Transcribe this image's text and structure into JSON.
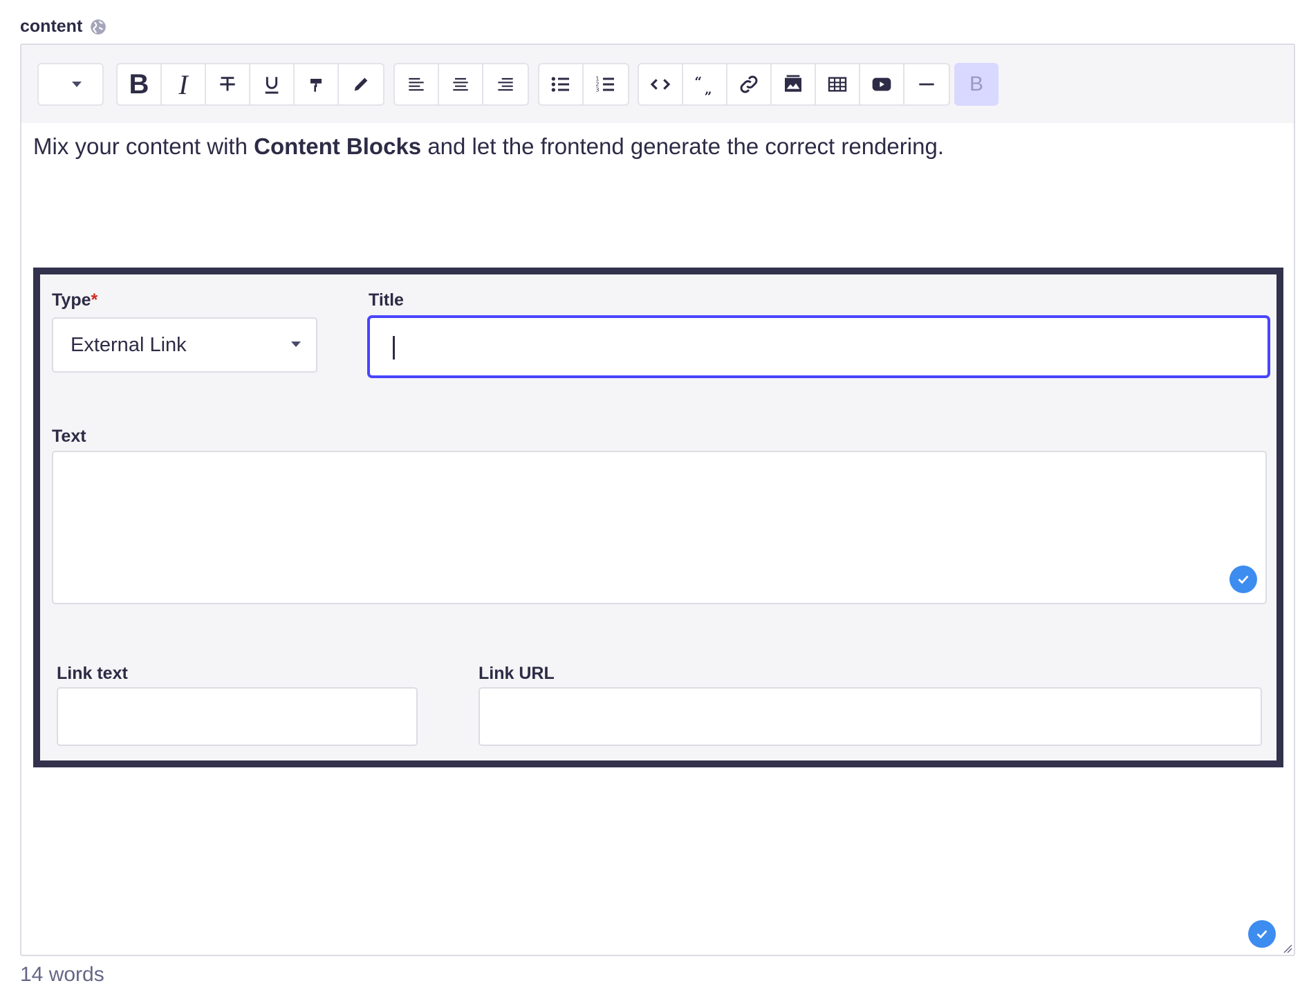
{
  "field": {
    "label": "content",
    "globe_icon": "globe-icon"
  },
  "toolbar": {
    "heading_select_value": "",
    "buttons": {
      "bold": "B",
      "italic": "I",
      "preview": "B"
    }
  },
  "editor": {
    "text_before": "Mix your content with ",
    "text_bold": "Content Blocks",
    "text_after": " and let the frontend generate the correct rendering."
  },
  "block": {
    "type_label": "Type",
    "type_required": "*",
    "type_value": "External Link",
    "title_label": "Title",
    "title_value": "",
    "text_label": "Text",
    "link_text_label": "Link text",
    "link_url_label": "Link URL"
  },
  "footer": {
    "word_count": "14 words"
  },
  "colors": {
    "accent": "#4945ff",
    "block_border": "#32324d",
    "check": "#3d8cf0",
    "required": "#d02b20"
  }
}
